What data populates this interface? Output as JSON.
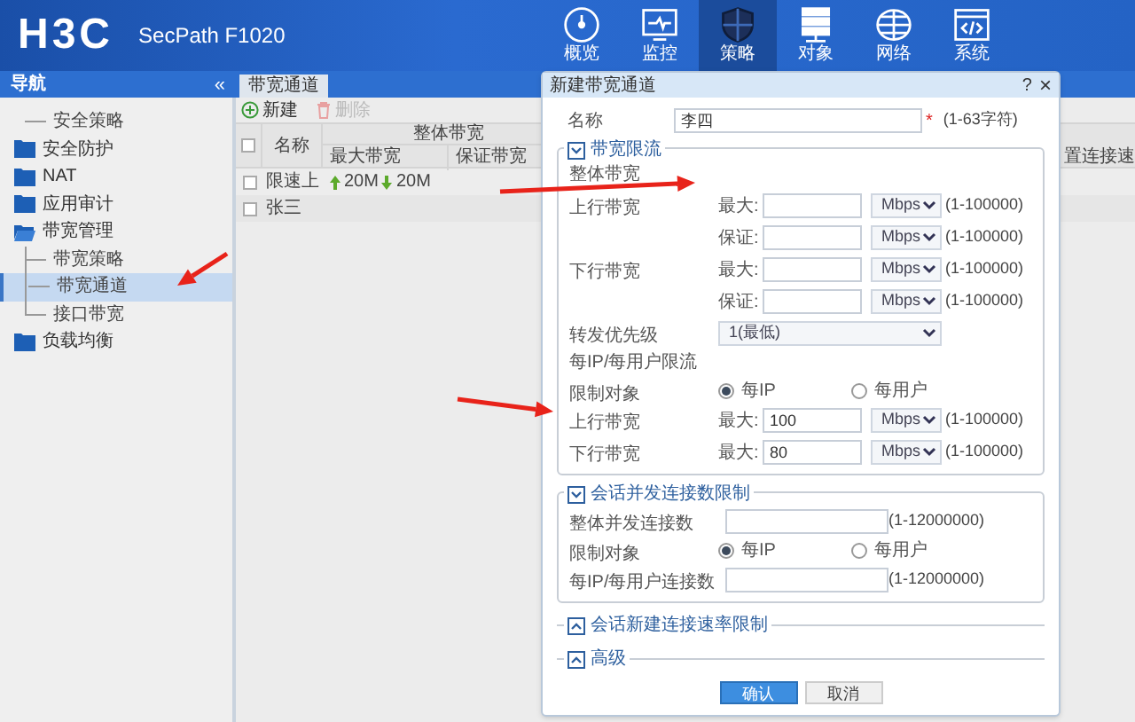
{
  "header": {
    "logo": "H3C",
    "product": "SecPath F1020",
    "nav": [
      {
        "label": "概览",
        "selected": false
      },
      {
        "label": "监控",
        "selected": false
      },
      {
        "label": "策略",
        "selected": true
      },
      {
        "label": "对象",
        "selected": false
      },
      {
        "label": "网络",
        "selected": false
      },
      {
        "label": "系统",
        "selected": false
      }
    ]
  },
  "sidebar": {
    "title": "导航",
    "collapse": "«",
    "items": [
      {
        "label": "安全策略",
        "kind": "leaf",
        "selected": false
      },
      {
        "label": "安全防护",
        "kind": "folder",
        "expanded": false
      },
      {
        "label": "NAT",
        "kind": "folder",
        "expanded": false
      },
      {
        "label": "应用审计",
        "kind": "folder",
        "expanded": false
      },
      {
        "label": "带宽管理",
        "kind": "folder",
        "expanded": true,
        "children": [
          {
            "label": "带宽策略",
            "kind": "leaf",
            "selected": false
          },
          {
            "label": "带宽通道",
            "kind": "leaf",
            "selected": true
          },
          {
            "label": "接口带宽",
            "kind": "leaf",
            "selected": false
          }
        ]
      },
      {
        "label": "负载均衡",
        "kind": "folder",
        "expanded": false
      }
    ]
  },
  "tabs": [
    {
      "label": "带宽通道",
      "selected": true
    }
  ],
  "toolbar": [
    {
      "label": "新建",
      "disabled": false
    },
    {
      "label": "删除",
      "disabled": true
    }
  ],
  "table": {
    "header_checked": false,
    "columns": [
      {
        "label": "名称"
      },
      {
        "label": "整体带宽",
        "children": [
          {
            "label": "最大带宽"
          },
          {
            "label": "保证带宽"
          }
        ]
      },
      {
        "label": "置连接速"
      }
    ],
    "rows": [
      {
        "checked": false,
        "name": "限速上",
        "max_up": "20M",
        "max_down": "20M"
      },
      {
        "checked": false,
        "name": "张三"
      }
    ]
  },
  "dialog": {
    "title": "新建带宽通道",
    "help": "?",
    "close": "×",
    "name_field": {
      "label": "名称",
      "value": "李四",
      "required": "*",
      "hint": "(1-63字符)"
    },
    "sections": [
      {
        "title": "带宽限流",
        "expanded": true,
        "rows": [
          {
            "kind": "heading",
            "label": "整体带宽"
          },
          {
            "kind": "input",
            "label": "上行带宽",
            "sublabel": "最大:",
            "unit": "Mbps",
            "hint": "(1-100000)"
          },
          {
            "kind": "input",
            "sublabel": "保证:",
            "unit": "Mbps",
            "hint": "(1-100000)"
          },
          {
            "kind": "input",
            "label": "下行带宽",
            "sublabel": "最大:",
            "unit": "Mbps",
            "hint": "(1-100000)"
          },
          {
            "kind": "input",
            "sublabel": "保证:",
            "unit": "Mbps",
            "hint": "(1-100000)"
          },
          {
            "kind": "select",
            "label": "转发优先级",
            "value": "1(最低)"
          },
          {
            "kind": "heading",
            "label": "每IP/每用户限流"
          },
          {
            "kind": "radio",
            "label": "限制对象",
            "options": [
              {
                "label": "每IP",
                "selected": true
              },
              {
                "label": "每用户",
                "selected": false
              }
            ]
          },
          {
            "kind": "input",
            "label": "上行带宽",
            "sublabel": "最大:",
            "value": "100",
            "unit": "Mbps",
            "hint": "(1-100000)"
          },
          {
            "kind": "input",
            "label": "下行带宽",
            "sublabel": "最大:",
            "value": "80",
            "unit": "Mbps",
            "hint": "(1-100000)"
          }
        ]
      },
      {
        "title": "会话并发连接数限制",
        "expanded": true,
        "rows": [
          {
            "kind": "field",
            "label": "整体并发连接数",
            "hint": "(1-12000000)"
          },
          {
            "kind": "radio",
            "label": "限制对象",
            "options": [
              {
                "label": "每IP",
                "selected": true
              },
              {
                "label": "每用户",
                "selected": false
              }
            ]
          },
          {
            "kind": "field",
            "label": "每IP/每用户连接数",
            "hint": "(1-12000000)"
          }
        ]
      },
      {
        "title": "会话新建连接速率限制",
        "expanded": false
      },
      {
        "title": "高级",
        "expanded": false
      }
    ],
    "buttons": [
      {
        "label": "确认",
        "primary": true
      },
      {
        "label": "取消",
        "primary": false
      }
    ]
  }
}
